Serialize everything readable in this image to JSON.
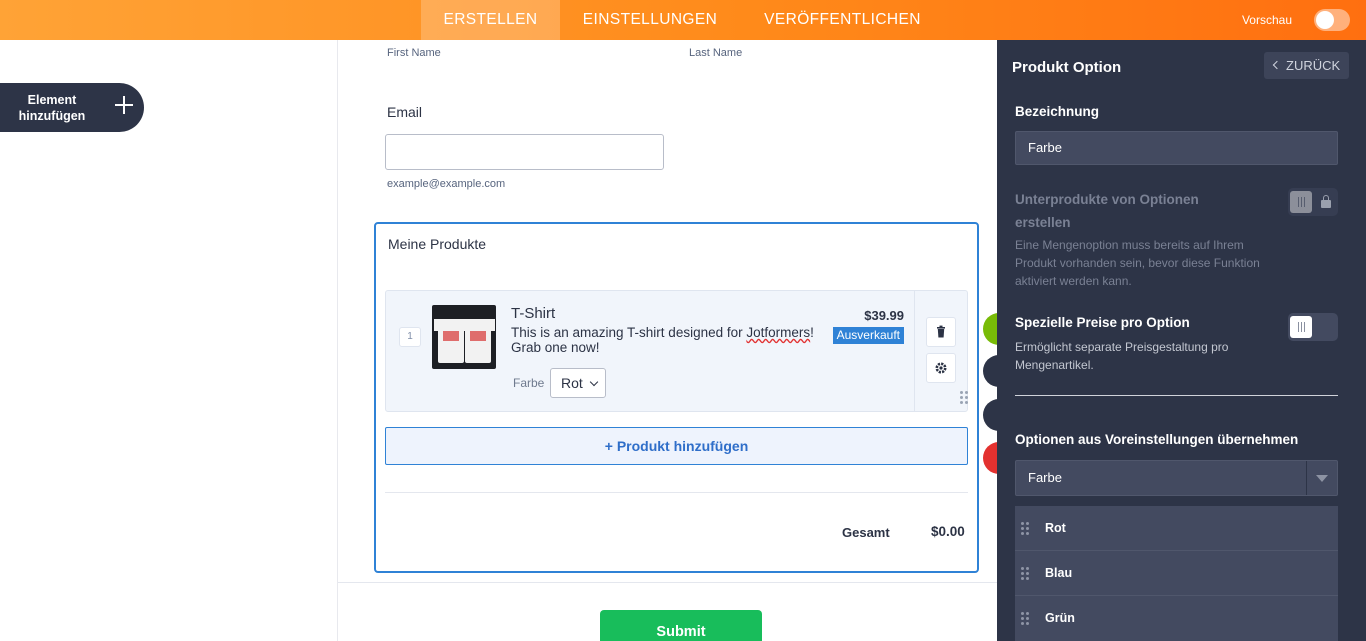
{
  "topbar": {
    "tabs": [
      {
        "label": "ERSTELLEN",
        "active": true
      },
      {
        "label": "EINSTELLUNGEN",
        "active": false
      },
      {
        "label": "VERÖFFENTLICHEN",
        "active": false
      }
    ],
    "preview_label": "Vorschau",
    "preview_on": false
  },
  "left": {
    "add_element_label": "Element hinzufügen"
  },
  "form": {
    "first_name_sublabel": "First Name",
    "last_name_sublabel": "Last Name",
    "email_label": "Email",
    "email_value": "",
    "email_sublabel": "example@example.com",
    "products": {
      "title": "Meine Produkte",
      "items": [
        {
          "quantity": "1",
          "name": "T-Shirt",
          "description_pre": "This is an amazing T-shirt designed for ",
          "description_misspelled": "Jotformers",
          "description_post": "! Grab one now!",
          "price": "$39.99",
          "badge": "Ausverkauft",
          "option_label": "Farbe",
          "option_value": "Rot"
        }
      ],
      "add_product_label": "+ Produkt hinzufügen",
      "total_label": "Gesamt",
      "total_value": "$0.00"
    },
    "submit_label": "Submit"
  },
  "panel": {
    "title": "Produkt Option",
    "back_label": "ZURÜCK",
    "name_heading": "Bezeichnung",
    "name_value": "Farbe",
    "subproducts_heading": "Unterprodukte von Optionen erstellen",
    "subproducts_help": "Eine Mengenoption muss bereits auf Ihrem Produkt vorhanden sein, bevor diese Funktion aktiviert werden kann.",
    "special_prices_heading": "Spezielle Preise pro Option",
    "special_prices_help": "Ermöglicht separate Preisgestaltung pro Mengenartikel.",
    "presets_heading": "Optionen aus Voreinstellungen übernehmen",
    "presets_value": "Farbe",
    "options": [
      "Rot",
      "Blau",
      "Grün"
    ]
  },
  "colors": {
    "accent_orange": "#ff8a1a",
    "panel_bg": "#2d3447",
    "selection_blue": "#2f82d6",
    "submit_green": "#18bd5b"
  }
}
